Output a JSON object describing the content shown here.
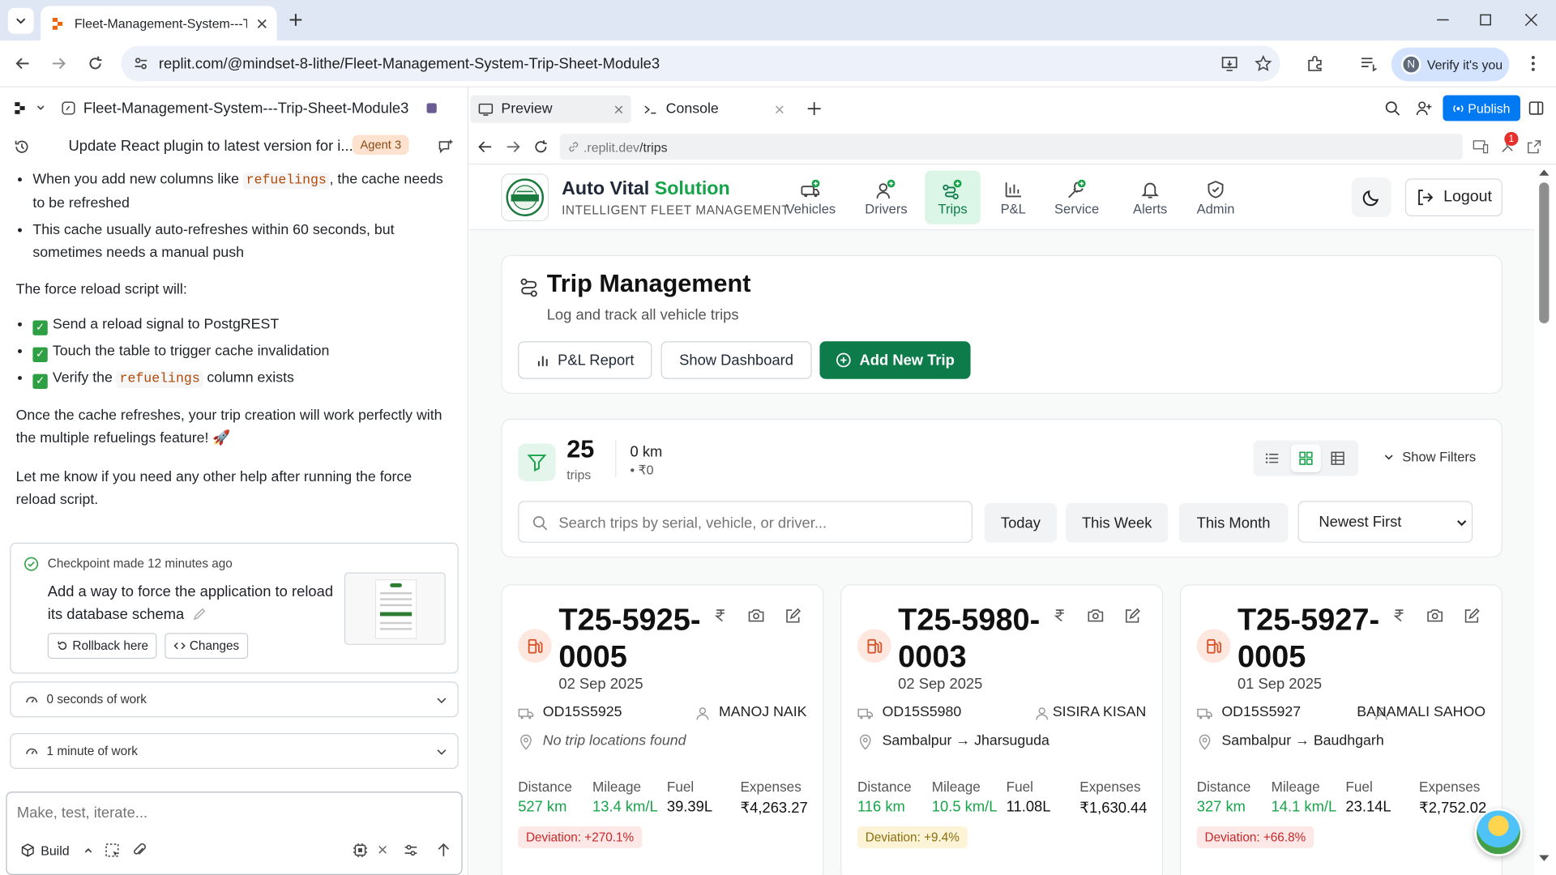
{
  "browser": {
    "tab_title": "Fleet-Management-System---Tr",
    "url": "replit.com/@mindset-8-lithe/Fleet-Management-System-Trip-Sheet-Module3",
    "verify_label": "Verify it's you",
    "avatar_letter": "N"
  },
  "workspace": {
    "project_name": "Fleet-Management-System---Trip-Sheet-Module3",
    "chat_title": "Update React plugin to latest version for i...",
    "agent_badge": "Agent 3",
    "bullets1": [
      {
        "pre": "When you add new columns like ",
        "code": "refuelings",
        "post": ", the cache needs to be refreshed"
      },
      {
        "pre": "This cache usually auto-refreshes within 60 seconds, but sometimes needs a manual push",
        "code": "",
        "post": ""
      }
    ],
    "para1": "The force reload script will:",
    "bullets2": [
      {
        "pre": "Send a reload signal to PostgREST",
        "code": "",
        "post": ""
      },
      {
        "pre": "Touch the table to trigger cache invalidation",
        "code": "",
        "post": ""
      },
      {
        "pre": "Verify the ",
        "code": "refuelings",
        "post": " column exists"
      }
    ],
    "para2": "Once the cache refreshes, your trip creation will work perfectly with the multiple refuelings feature! 🚀",
    "para3": "Let me know if you need any other help after running the force reload script.",
    "checkpoint": {
      "title": "Checkpoint made 12 minutes ago",
      "desc": "Add a way to force the application to reload its database schema",
      "rollback": "Rollback here",
      "changes": "Changes"
    },
    "work1": "0 seconds of work",
    "work2": "1 minute of work",
    "composer_placeholder": "Make, test, iterate...",
    "build_label": "Build"
  },
  "ide": {
    "tab_preview": "Preview",
    "tab_console": "Console",
    "publish": "Publish",
    "preview_url_host": ".replit.dev",
    "preview_url_path": "/trips",
    "notif_count": "1"
  },
  "app": {
    "brand_main": "Auto Vital",
    "brand_accent": "Solution",
    "brand_sub": "INTELLIGENT FLEET MANAGEMENT",
    "nav": [
      "Vehicles",
      "Drivers",
      "Trips",
      "P&L",
      "Service",
      "Alerts",
      "Admin"
    ],
    "active_nav": "Trips",
    "logout": "Logout",
    "page_title": "Trip Management",
    "page_subtitle": "Log and track all vehicle trips",
    "btn_pl": "P&L Report",
    "btn_dashboard": "Show Dashboard",
    "btn_add": "Add New Trip",
    "trip_count": "25",
    "trip_count_label": "trips",
    "total_km": "0 km",
    "total_amount": "• ₹0",
    "show_filters": "Show Filters",
    "search_placeholder": "Search trips by serial, vehicle, or driver...",
    "filters": [
      "Today",
      "This Week",
      "This Month"
    ],
    "sort_selected": "Newest First",
    "trips": [
      {
        "serial1": "T25-5925-",
        "serial2": "0005",
        "date": "02 Sep 2025",
        "vehicle": "OD15S5925",
        "driver": "MANOJ NAIK",
        "route_text": "No trip locations found",
        "distance": "527 km",
        "mileage": "13.4 km/L",
        "fuel": "39.39L",
        "expenses": "₹4,263.27",
        "deviation": "Deviation: +270.1%",
        "dev_kind": "red"
      },
      {
        "serial1": "T25-5980-",
        "serial2": "0003",
        "date": "02 Sep 2025",
        "vehicle": "OD15S5980",
        "driver": "SISIRA KISAN",
        "route_text": "Sambalpur → Jharsuguda",
        "distance": "116 km",
        "mileage": "10.5 km/L",
        "fuel": "11.08L",
        "expenses": "₹1,630.44",
        "deviation": "Deviation: +9.4%",
        "dev_kind": "yellow"
      },
      {
        "serial1": "T25-5927-",
        "serial2": "0005",
        "date": "01 Sep 2025",
        "vehicle": "OD15S5927",
        "driver": "BANAMALI SAHOO",
        "route_text": "Sambalpur → Baudhgarh",
        "distance": "327 km",
        "mileage": "14.1 km/L",
        "fuel": "23.14L",
        "expenses": "₹2,752.02",
        "deviation": "Deviation: +66.8%",
        "dev_kind": "red"
      }
    ],
    "stat_labels": [
      "Distance",
      "Mileage",
      "Fuel",
      "Expenses"
    ]
  },
  "colors": {
    "accent": "#16a34a",
    "brand_green": "#0e7c4a",
    "publish_blue": "#0079f2"
  }
}
